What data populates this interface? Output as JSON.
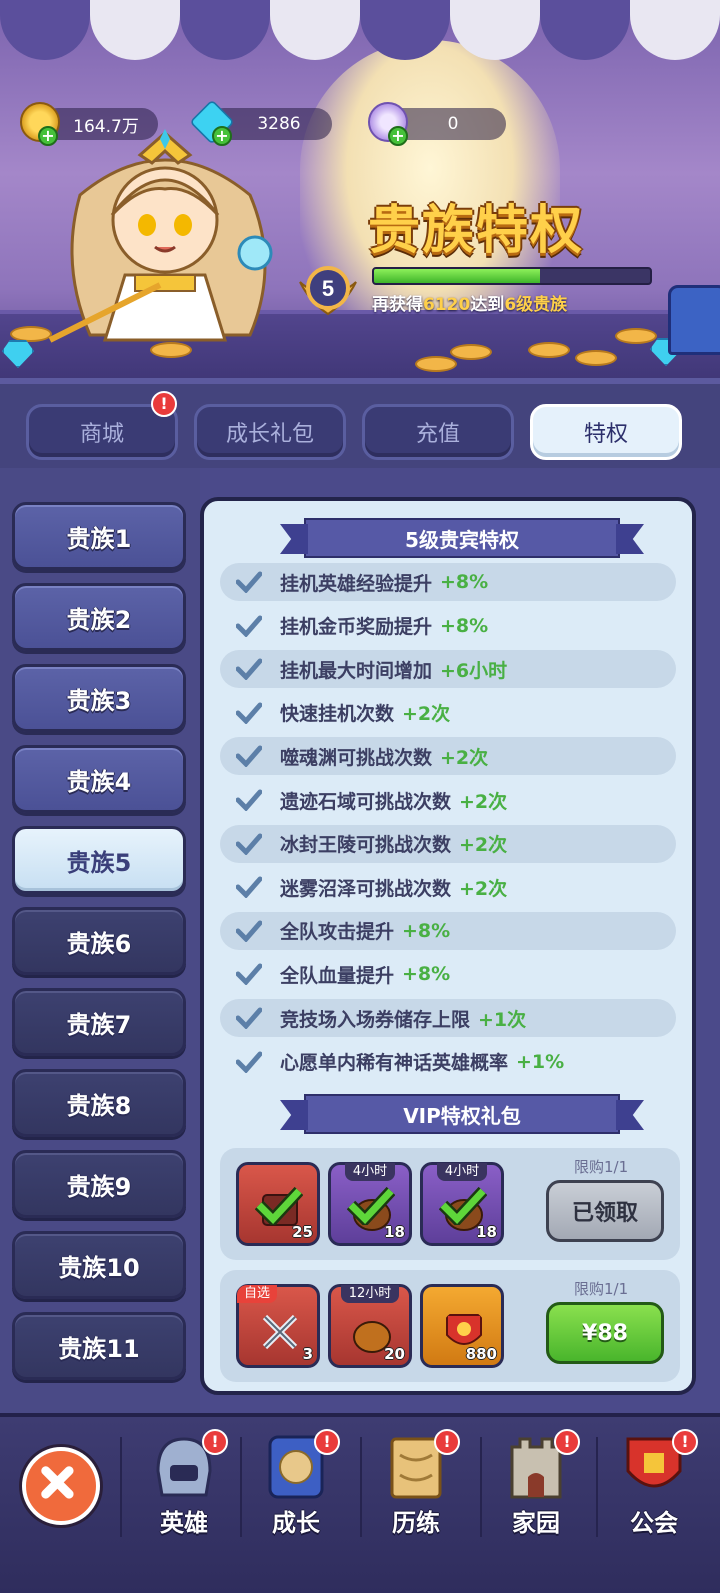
{
  "currencies": [
    {
      "name": "gold",
      "value": "164.7万"
    },
    {
      "name": "diamond",
      "value": "3286"
    },
    {
      "name": "purple-token",
      "value": "0"
    }
  ],
  "header": {
    "title": "贵族特权",
    "vip_level": "5",
    "progress_fraction": 0.6,
    "progress_prefix": "再获得",
    "progress_amount": "6120",
    "progress_mid": "达到",
    "progress_target": "6级贵族"
  },
  "tabs": [
    {
      "label": "商城",
      "badge": "!"
    },
    {
      "label": "成长礼包"
    },
    {
      "label": "充值"
    },
    {
      "label": "特权"
    }
  ],
  "nobility_levels": [
    "贵族1",
    "贵族2",
    "贵族3",
    "贵族4",
    "贵族5",
    "贵族6",
    "贵族7",
    "贵族8",
    "贵族9",
    "贵族10",
    "贵族11"
  ],
  "privileges": {
    "title": "5级贵宾特权",
    "perks": [
      {
        "text": "挂机英雄经验提升",
        "bonus": "+8%"
      },
      {
        "text": "挂机金币奖励提升",
        "bonus": "+8%"
      },
      {
        "text": "挂机最大时间增加",
        "bonus": "+6小时"
      },
      {
        "text": "快速挂机次数",
        "bonus": "+2次"
      },
      {
        "text": "噬魂渊可挑战次数",
        "bonus": "+2次"
      },
      {
        "text": "遗迹石域可挑战次数",
        "bonus": "+2次"
      },
      {
        "text": "冰封王陵可挑战次数",
        "bonus": "+2次"
      },
      {
        "text": "迷雾沼泽可挑战次数",
        "bonus": "+2次"
      },
      {
        "text": "全队攻击提升",
        "bonus": "+8%"
      },
      {
        "text": "全队血量提升",
        "bonus": "+8%"
      },
      {
        "text": "竞技场入场券储存上限",
        "bonus": "+1次"
      },
      {
        "text": "心愿单内稀有神话英雄概率",
        "bonus": "+1%"
      }
    ]
  },
  "gift_section": {
    "title": "VIP特权礼包",
    "packs": [
      {
        "limit": "限购1/1",
        "button": "已领取",
        "items": [
          {
            "tag": "",
            "count": "25"
          },
          {
            "tag": "4小时",
            "count": "18"
          },
          {
            "tag": "4小时",
            "count": "18"
          }
        ]
      },
      {
        "limit": "限购1/1",
        "button": "¥88",
        "items": [
          {
            "tag": "自选",
            "count": "3"
          },
          {
            "tag": "12小时",
            "count": "20"
          },
          {
            "tag": "",
            "count": "880"
          }
        ]
      }
    ]
  },
  "bottom_nav": [
    {
      "label": "英雄",
      "badge": "!"
    },
    {
      "label": "成长",
      "badge": "!"
    },
    {
      "label": "历练",
      "badge": "!"
    },
    {
      "label": "家园",
      "badge": "!"
    },
    {
      "label": "公会",
      "badge": "!"
    }
  ]
}
